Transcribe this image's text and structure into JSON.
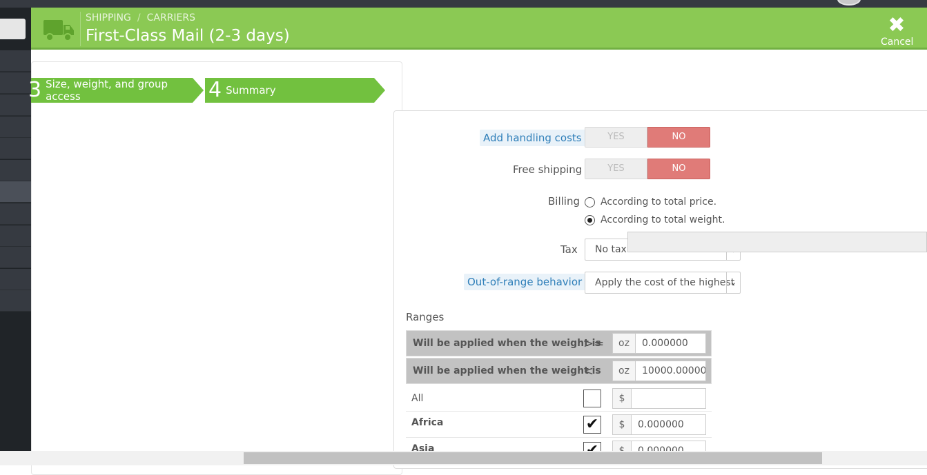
{
  "header": {
    "breadcrumb": [
      "SHIPPING",
      "CARRIERS"
    ],
    "breadcrumb_sep": "/",
    "title": "First-Class Mail (2-3 days)",
    "cancel_label": "Cancel",
    "truck_icon": "truck-icon",
    "accent": "#8bc954"
  },
  "steps": [
    {
      "num": "3",
      "label": "Size, weight, and group access"
    },
    {
      "num": "4",
      "label": "Summary"
    }
  ],
  "form": {
    "handling": {
      "label": "Add handling costs",
      "yes": "YES",
      "no": "NO",
      "value": "NO"
    },
    "free_shipping": {
      "label": "Free shipping",
      "yes": "YES",
      "no": "NO",
      "value": "NO"
    },
    "billing": {
      "label": "Billing",
      "options": [
        "According to total price.",
        "According to total weight."
      ],
      "selected": "According to total weight."
    },
    "tax": {
      "label": "Tax",
      "value": "No tax"
    },
    "out_of_range": {
      "label": "Out-of-range behavior",
      "value": "Apply the cost of the highest"
    }
  },
  "ranges": {
    "title": "Ranges",
    "rows": [
      {
        "text": "Will be applied when the weight is",
        "op": ">=",
        "unit": "oz",
        "value": "0.000000"
      },
      {
        "text": "Will be applied when the weight is",
        "op": "<",
        "unit": "oz",
        "value": "10000.000000"
      }
    ],
    "zones": [
      {
        "name": "All",
        "checked": false,
        "currency": "$",
        "value": ""
      },
      {
        "name": "Africa",
        "checked": true,
        "currency": "$",
        "value": "0.000000"
      },
      {
        "name": "Asia",
        "checked": true,
        "currency": "$",
        "value": "0.000000"
      }
    ]
  }
}
